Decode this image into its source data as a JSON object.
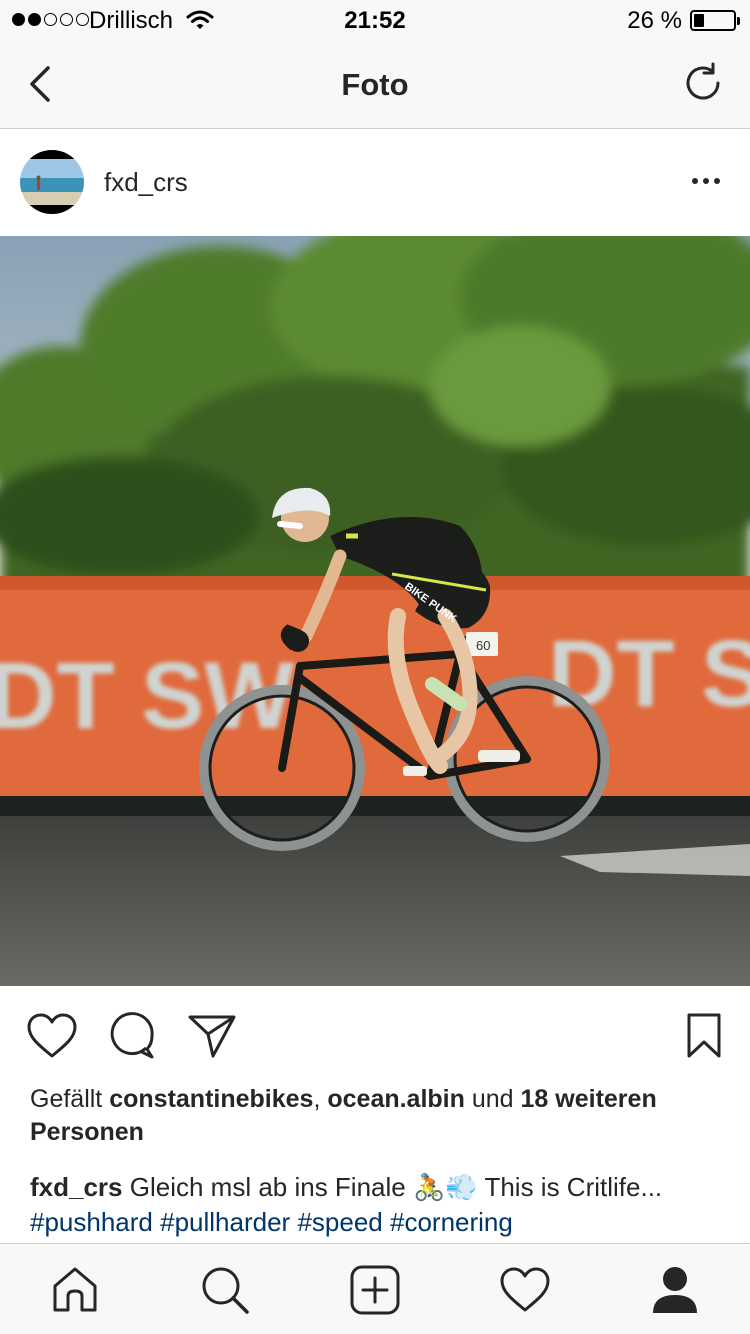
{
  "status": {
    "carrier": "Drillisch",
    "time": "21:52",
    "battery_text": "26 %",
    "battery_level": 0.26,
    "signal_bars_filled": 2,
    "signal_bars_total": 5
  },
  "nav": {
    "title": "Foto",
    "back_icon": "chevron-left-icon",
    "refresh_icon": "refresh-icon"
  },
  "post": {
    "username": "fxd_crs",
    "photo_text": {
      "banner_left": "DT SW",
      "banner_right": "DT S",
      "jersey": "BIKE PUNK",
      "number_plate": "60"
    },
    "likes": {
      "prefix": "Gefällt",
      "user1": "constantinebikes",
      "sep": ",",
      "user2": "ocean.albin",
      "and": "und",
      "others": "18 weiteren Personen"
    },
    "caption": {
      "user": "fxd_crs",
      "text": "Gleich msl ab ins Finale 🚴💨 This is Critlife...",
      "hashtags": [
        "#pushhard",
        "#pullharder",
        "#speed",
        "#cornering"
      ]
    }
  },
  "colors": {
    "text": "#262626",
    "hashtag": "#003569",
    "bar_bg": "#f8f8f8",
    "divider": "#d0d0d0"
  }
}
